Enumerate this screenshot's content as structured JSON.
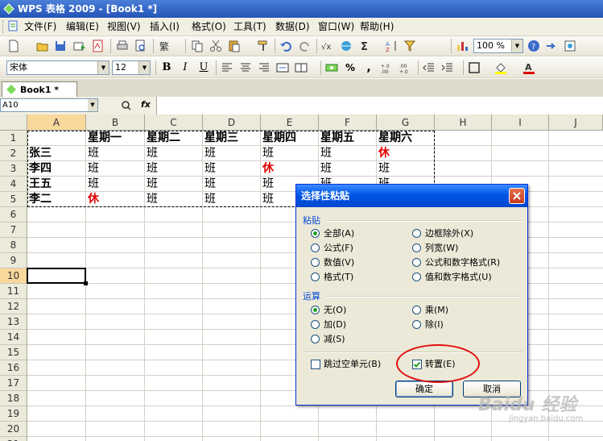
{
  "window": {
    "title": "WPS 表格  2009 - [Book1 *]"
  },
  "menu": [
    "文件(F)",
    "编辑(E)",
    "视图(V)",
    "插入(I)",
    "格式(O)",
    "工具(T)",
    "数据(D)",
    "窗口(W)",
    "帮助(H)"
  ],
  "toolbar": {
    "zoom": "100 %",
    "font_name": "宋体",
    "font_size": "12",
    "bold": "B",
    "italic": "I",
    "underline": "U",
    "percent": "%",
    "comma": ",",
    "sigma": "Σ"
  },
  "tab": {
    "label": "Book1 *"
  },
  "formula": {
    "cell_ref": "A10",
    "fx": "fx",
    "value": ""
  },
  "sheet": {
    "columns": [
      "A",
      "B",
      "C",
      "D",
      "E",
      "F",
      "G",
      "H",
      "I",
      "J"
    ],
    "rows": [
      "1",
      "2",
      "3",
      "4",
      "5",
      "6",
      "7",
      "8",
      "9",
      "10",
      "11",
      "12",
      "13",
      "14",
      "15",
      "16",
      "17",
      "18",
      "19",
      "20",
      "21"
    ],
    "selected_col": "A",
    "selected_row": "10",
    "header_row": [
      "",
      "星期一",
      "星期二",
      "星期三",
      "星期四",
      "星期五",
      "星期六"
    ],
    "data": [
      {
        "name": "张三",
        "cells": [
          "班",
          "班",
          "班",
          "班",
          "班",
          "休"
        ]
      },
      {
        "name": "李四",
        "cells": [
          "班",
          "班",
          "班",
          "休",
          "班",
          "班"
        ]
      },
      {
        "name": "王五",
        "cells": [
          "班",
          "班",
          "班",
          "班",
          "班",
          "班"
        ]
      },
      {
        "name": "李二",
        "cells": [
          "休",
          "班",
          "班",
          "班",
          "班",
          "班"
        ]
      }
    ],
    "rest_value": "休"
  },
  "dialog": {
    "title": "选择性粘贴",
    "paste_group": "粘贴",
    "paste_options": [
      {
        "label": "全部(A)",
        "checked": true
      },
      {
        "label": "边框除外(X)",
        "checked": false
      },
      {
        "label": "公式(F)",
        "checked": false
      },
      {
        "label": "列宽(W)",
        "checked": false
      },
      {
        "label": "数值(V)",
        "checked": false
      },
      {
        "label": "公式和数字格式(R)",
        "checked": false
      },
      {
        "label": "格式(T)",
        "checked": false
      },
      {
        "label": "值和数字格式(U)",
        "checked": false
      }
    ],
    "op_group": "运算",
    "op_options": [
      {
        "label": "无(O)",
        "checked": true
      },
      {
        "label": "乘(M)",
        "checked": false
      },
      {
        "label": "加(D)",
        "checked": false
      },
      {
        "label": "除(I)",
        "checked": false
      },
      {
        "label": "减(S)",
        "checked": false
      }
    ],
    "skip_blanks": {
      "label": "跳过空单元(B)",
      "checked": false
    },
    "transpose": {
      "label": "转置(E)",
      "checked": true
    },
    "ok_label": "确定",
    "cancel_label": "取消"
  },
  "watermark": {
    "brand": "Baidu 经验",
    "url": "jingyan.baidu.com"
  },
  "colors": {
    "accent_red": "#e00000",
    "header_sel": "#f9d89c",
    "title_blue": "#0055e5"
  }
}
